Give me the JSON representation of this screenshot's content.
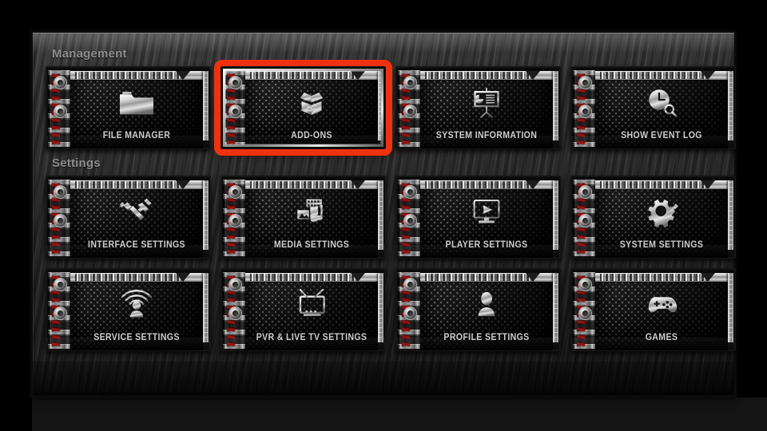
{
  "window": {
    "background_color": "#2b2b2b",
    "outer_background_color": "#000000"
  },
  "focus": {
    "focused_tile": "ADD-ONS",
    "highlight_color": "#f0310f",
    "frame_color": "#cfcfcf"
  },
  "sections": [
    {
      "id": "management",
      "header": "Management",
      "rows": [
        [
          {
            "label": "FILE MANAGER",
            "icon": "folder-icon",
            "focused": false
          },
          {
            "label": "ADD-ONS",
            "icon": "open-box-icon",
            "focused": true
          },
          {
            "label": "SYSTEM INFORMATION",
            "icon": "presentation-icon",
            "focused": false
          },
          {
            "label": "SHOW EVENT LOG",
            "icon": "clock-search-icon",
            "focused": false
          }
        ]
      ]
    },
    {
      "id": "settings",
      "header": "Settings",
      "rows": [
        [
          {
            "label": "INTERFACE SETTINGS",
            "icon": "wrench-screwdriver-icon",
            "focused": false
          },
          {
            "label": "MEDIA SETTINGS",
            "icon": "media-filmstrip-icon",
            "focused": false
          },
          {
            "label": "PLAYER SETTINGS",
            "icon": "monitor-play-icon",
            "focused": false
          },
          {
            "label": "SYSTEM SETTINGS",
            "icon": "gear-screwdriver-icon",
            "focused": false
          }
        ],
        [
          {
            "label": "SERVICE SETTINGS",
            "icon": "broadcast-person-icon",
            "focused": false
          },
          {
            "label": "PVR & LIVE TV SETTINGS",
            "icon": "tv-antenna-icon",
            "focused": false
          },
          {
            "label": "PROFILE SETTINGS",
            "icon": "person-bust-icon",
            "focused": false
          },
          {
            "label": "GAMES",
            "icon": "gamepad-icon",
            "focused": false
          }
        ]
      ]
    }
  ]
}
